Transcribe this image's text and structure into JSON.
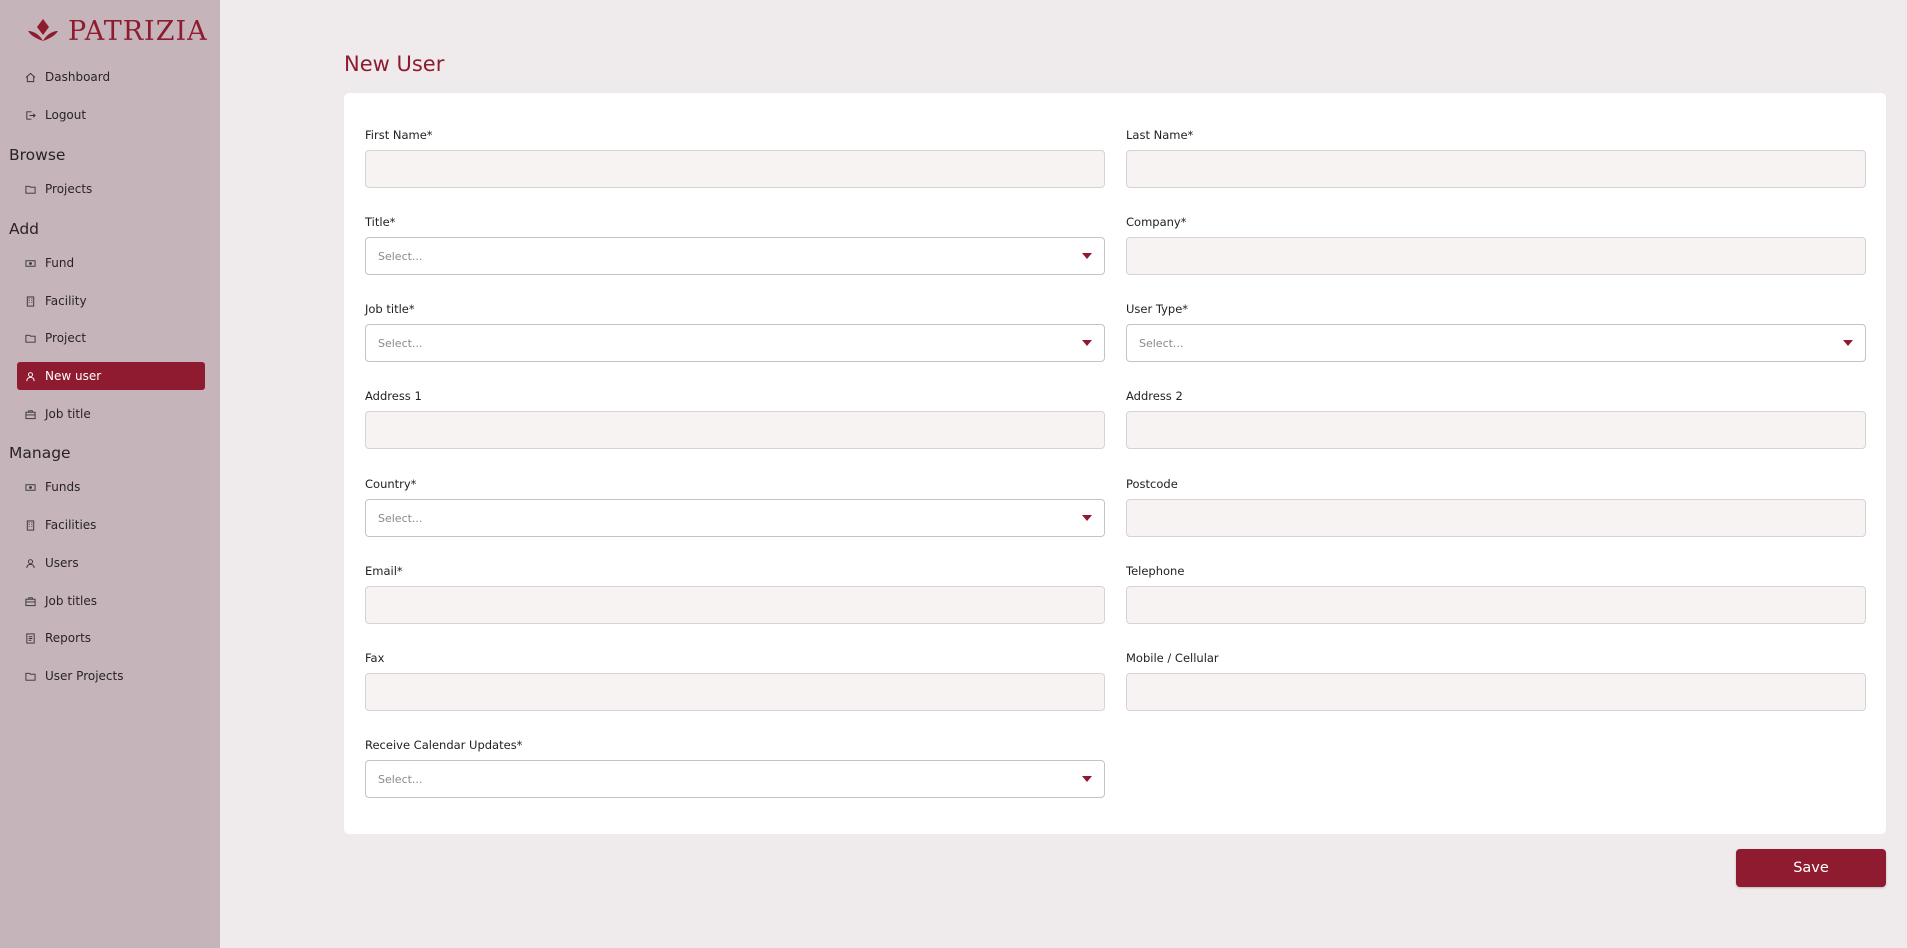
{
  "brand": {
    "name": "PATRIZIA",
    "color": "#8e1b30"
  },
  "sidebar": {
    "top_items": [
      {
        "label": "Dashboard",
        "icon": "home-icon"
      },
      {
        "label": "Logout",
        "icon": "logout-icon"
      }
    ],
    "browse": {
      "heading": "Browse",
      "items": [
        {
          "label": "Projects",
          "icon": "folder-icon"
        }
      ]
    },
    "add": {
      "heading": "Add",
      "items": [
        {
          "label": "Fund",
          "icon": "money-icon"
        },
        {
          "label": "Facility",
          "icon": "building-icon"
        },
        {
          "label": "Project",
          "icon": "folder-icon"
        },
        {
          "label": "New user",
          "icon": "user-icon",
          "active": true
        },
        {
          "label": "Job title",
          "icon": "briefcase-icon"
        }
      ]
    },
    "manage": {
      "heading": "Manage",
      "items": [
        {
          "label": "Funds",
          "icon": "money-icon"
        },
        {
          "label": "Facilities",
          "icon": "building-icon"
        },
        {
          "label": "Users",
          "icon": "user-icon"
        },
        {
          "label": "Job titles",
          "icon": "briefcase-icon"
        },
        {
          "label": "Reports",
          "icon": "report-icon"
        },
        {
          "label": "User Projects",
          "icon": "folder-icon"
        }
      ]
    }
  },
  "page": {
    "title": "New User"
  },
  "form": {
    "first_name": {
      "label": "First Name*",
      "value": ""
    },
    "last_name": {
      "label": "Last Name*",
      "value": ""
    },
    "title": {
      "label": "Title*",
      "placeholder": "Select..."
    },
    "company": {
      "label": "Company*",
      "value": ""
    },
    "job_title": {
      "label": "Job title*",
      "placeholder": "Select..."
    },
    "user_type": {
      "label": "User Type*",
      "placeholder": "Select..."
    },
    "address1": {
      "label": "Address 1",
      "value": ""
    },
    "address2": {
      "label": "Address 2",
      "value": ""
    },
    "country": {
      "label": "Country*",
      "placeholder": "Select..."
    },
    "postcode": {
      "label": "Postcode",
      "value": ""
    },
    "email": {
      "label": "Email*",
      "value": ""
    },
    "telephone": {
      "label": "Telephone",
      "value": ""
    },
    "fax": {
      "label": "Fax",
      "value": ""
    },
    "mobile": {
      "label": "Mobile / Cellular",
      "value": ""
    },
    "calendar_updates": {
      "label": "Receive Calendar Updates*",
      "placeholder": "Select..."
    }
  },
  "actions": {
    "save_label": "Save"
  }
}
